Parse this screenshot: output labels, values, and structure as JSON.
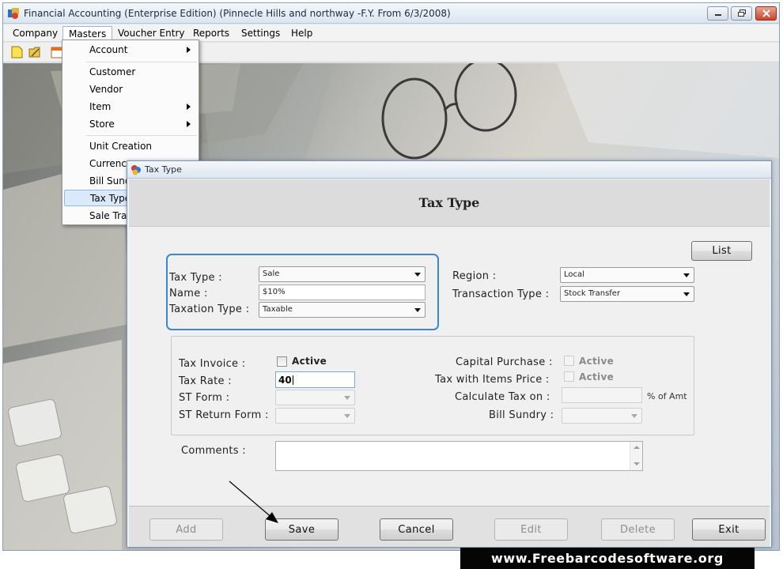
{
  "window": {
    "title": "Financial Accounting (Enterprise Edition) (Pinnecle Hills and northway -F.Y. From 6/3/2008)"
  },
  "menubar": {
    "items": [
      "Company",
      "Masters",
      "Voucher Entry",
      "Reports",
      "Settings",
      "Help"
    ],
    "open_item": "Masters"
  },
  "toolbar": {
    "icons": [
      "new-icon",
      "open-icon",
      "calendar-icon"
    ]
  },
  "masters_menu": {
    "items": [
      {
        "label": "Account",
        "submenu": true
      },
      {
        "label": "Customer",
        "submenu": false
      },
      {
        "label": "Vendor",
        "submenu": false
      },
      {
        "label": "Item",
        "submenu": true
      },
      {
        "label": "Store",
        "submenu": true
      },
      {
        "label": "Unit Creation",
        "submenu": false
      },
      {
        "label": "Currency",
        "submenu": false
      },
      {
        "label": "Bill Sundry",
        "submenu": false
      },
      {
        "label": "Tax Type",
        "submenu": false
      },
      {
        "label": "Sale Tra",
        "submenu": false
      }
    ],
    "highlighted": "Tax Type"
  },
  "dialog": {
    "window_title": "Tax Type",
    "heading": "Tax Type",
    "list_button": "List",
    "tax_type": {
      "label": "Tax Type :",
      "value": "Sale"
    },
    "name": {
      "label": "Name :",
      "value": "$10%"
    },
    "taxation_type": {
      "label": "Taxation Type :",
      "value": "Taxable"
    },
    "region": {
      "label": "Region :",
      "value": "Local"
    },
    "transaction_type": {
      "label": "Transaction Type :",
      "value": "Stock Transfer"
    },
    "tax_invoice": {
      "label": "Tax Invoice :",
      "checkbox_label": "Active",
      "checked": false
    },
    "tax_rate": {
      "label": "Tax Rate :",
      "value": "40"
    },
    "st_form": {
      "label": "ST Form :",
      "value": ""
    },
    "st_return_form": {
      "label": "ST Return Form :",
      "value": ""
    },
    "capital_purchase": {
      "label": "Capital Purchase :",
      "checkbox_label": "Active",
      "checked": false
    },
    "tax_with_items_price": {
      "label": "Tax with Items Price :",
      "checkbox_label": "Active",
      "checked": false
    },
    "calculate_tax_on": {
      "label": "Calculate Tax on :",
      "value": "",
      "suffix": "% of Amt"
    },
    "bill_sundry": {
      "label": "Bill Sundry :",
      "value": ""
    },
    "comments": {
      "label": "Comments :",
      "value": ""
    },
    "buttons": {
      "add": "Add",
      "save": "Save",
      "cancel": "Cancel",
      "edit": "Edit",
      "delete": "Delete",
      "exit": "Exit"
    }
  },
  "watermark": "www.Freebarcodesoftware.org"
}
